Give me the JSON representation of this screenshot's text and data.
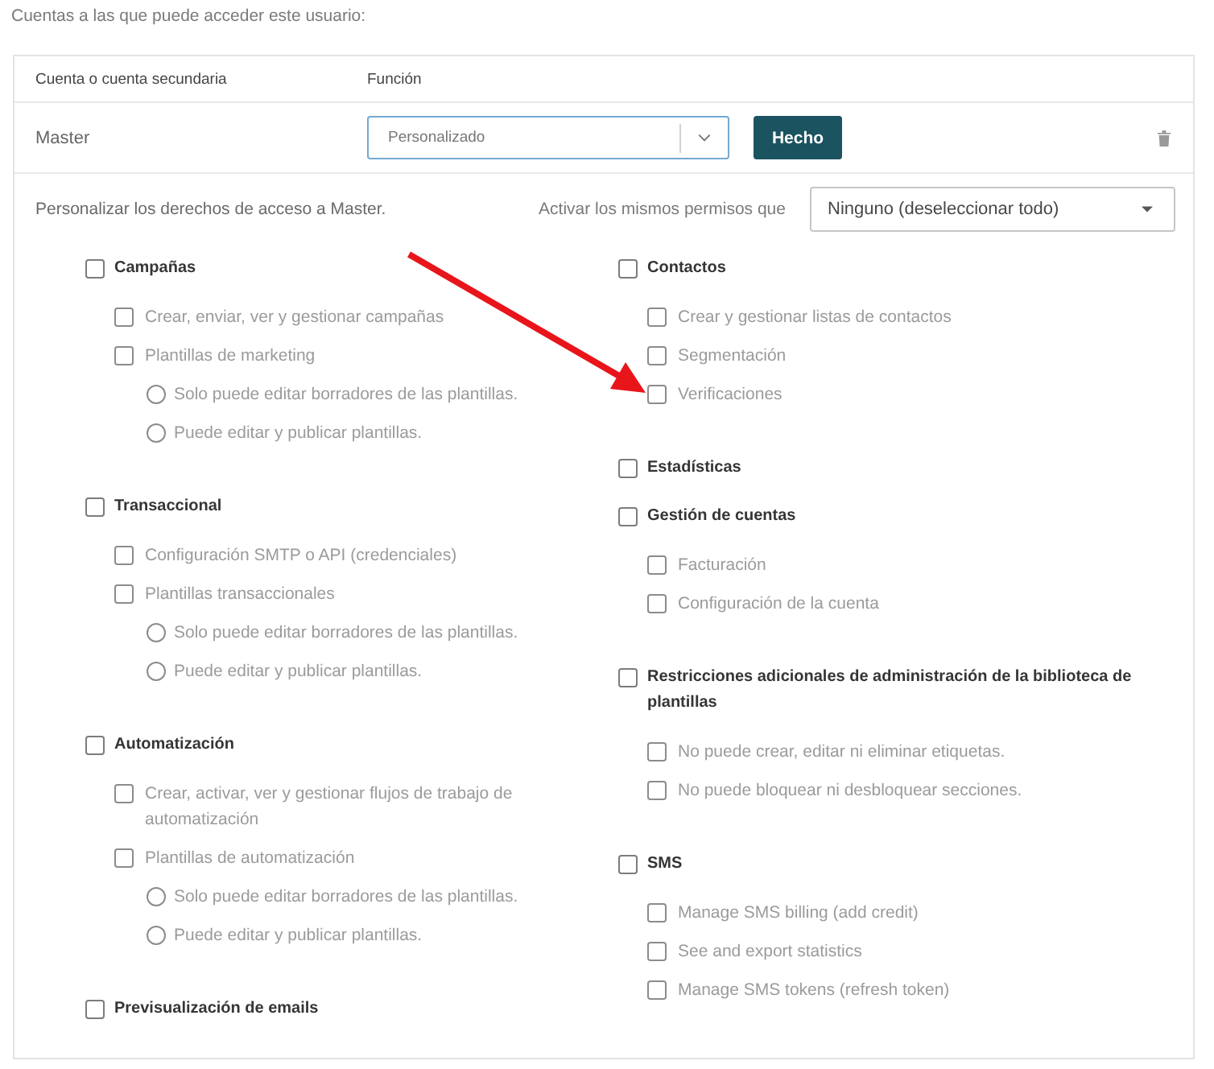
{
  "heading": "Cuentas a las que puede acceder este usuario:",
  "accounts_table": {
    "columns": [
      "Cuenta o cuenta secundaria",
      "Función"
    ],
    "row": {
      "account": "Master",
      "role_select": {
        "value": "Personalizado"
      },
      "done_button": "Hecho"
    }
  },
  "permissions": {
    "description": "Personalizar los derechos de acceso a Master.",
    "copy_label": "Activar los mismos permisos que",
    "copy_select": {
      "value": "Ninguno (deseleccionar todo)"
    },
    "columns": [
      {
        "groups": [
          {
            "kind": "group",
            "label": "Campañas",
            "checked": false,
            "children": [
              {
                "kind": "checkbox",
                "label": "Crear, enviar, ver y gestionar campañas",
                "checked": false
              },
              {
                "kind": "checkbox",
                "label": "Plantillas de marketing",
                "checked": false,
                "children": [
                  {
                    "kind": "radio",
                    "label": "Solo puede editar borradores de las plantillas.",
                    "selected": false
                  },
                  {
                    "kind": "radio",
                    "label": "Puede editar y publicar plantillas.",
                    "selected": false
                  }
                ]
              }
            ]
          },
          {
            "kind": "group",
            "label": "Transaccional",
            "checked": false,
            "children": [
              {
                "kind": "checkbox",
                "label": "Configuración SMTP o API (credenciales)",
                "checked": false
              },
              {
                "kind": "checkbox",
                "label": "Plantillas transaccionales",
                "checked": false,
                "children": [
                  {
                    "kind": "radio",
                    "label": "Solo puede editar borradores de las plantillas.",
                    "selected": false
                  },
                  {
                    "kind": "radio",
                    "label": "Puede editar y publicar plantillas.",
                    "selected": false
                  }
                ]
              }
            ]
          },
          {
            "kind": "group",
            "label": "Automatización",
            "checked": false,
            "children": [
              {
                "kind": "checkbox",
                "label": "Crear, activar, ver y gestionar flujos de trabajo de automatización",
                "checked": false
              },
              {
                "kind": "checkbox",
                "label": "Plantillas de automatización",
                "checked": false,
                "children": [
                  {
                    "kind": "radio",
                    "label": "Solo puede editar borradores de las plantillas.",
                    "selected": false
                  },
                  {
                    "kind": "radio",
                    "label": "Puede editar y publicar plantillas.",
                    "selected": false
                  }
                ]
              }
            ]
          },
          {
            "kind": "group",
            "label": "Previsualización de emails",
            "checked": false
          }
        ]
      },
      {
        "groups": [
          {
            "kind": "group",
            "label": "Contactos",
            "checked": false,
            "children": [
              {
                "kind": "checkbox",
                "label": "Crear y gestionar listas de contactos",
                "checked": false
              },
              {
                "kind": "checkbox",
                "label": "Segmentación",
                "checked": false
              },
              {
                "kind": "checkbox",
                "label": "Verificaciones",
                "checked": false
              }
            ]
          },
          {
            "kind": "group",
            "label": "Estadísticas",
            "checked": false
          },
          {
            "kind": "group",
            "label": "Gestión de cuentas",
            "checked": false,
            "children": [
              {
                "kind": "checkbox",
                "label": "Facturación",
                "checked": false
              },
              {
                "kind": "checkbox",
                "label": "Configuración de la cuenta",
                "checked": false
              }
            ]
          },
          {
            "kind": "group",
            "label": "Restricciones adicionales de administración de la biblioteca de plantillas",
            "checked": false,
            "children": [
              {
                "kind": "checkbox",
                "label": "No puede crear, editar ni eliminar etiquetas.",
                "checked": false
              },
              {
                "kind": "checkbox",
                "label": "No puede bloquear ni desbloquear secciones.",
                "checked": false
              }
            ]
          },
          {
            "kind": "group",
            "label": "SMS",
            "checked": false,
            "children": [
              {
                "kind": "checkbox",
                "label": "Manage SMS billing (add credit)",
                "checked": false
              },
              {
                "kind": "checkbox",
                "label": "See and export statistics",
                "checked": false
              },
              {
                "kind": "checkbox",
                "label": "Manage SMS tokens (refresh token)",
                "checked": false
              }
            ]
          }
        ]
      }
    ]
  },
  "annotation": {
    "kind": "arrow"
  }
}
